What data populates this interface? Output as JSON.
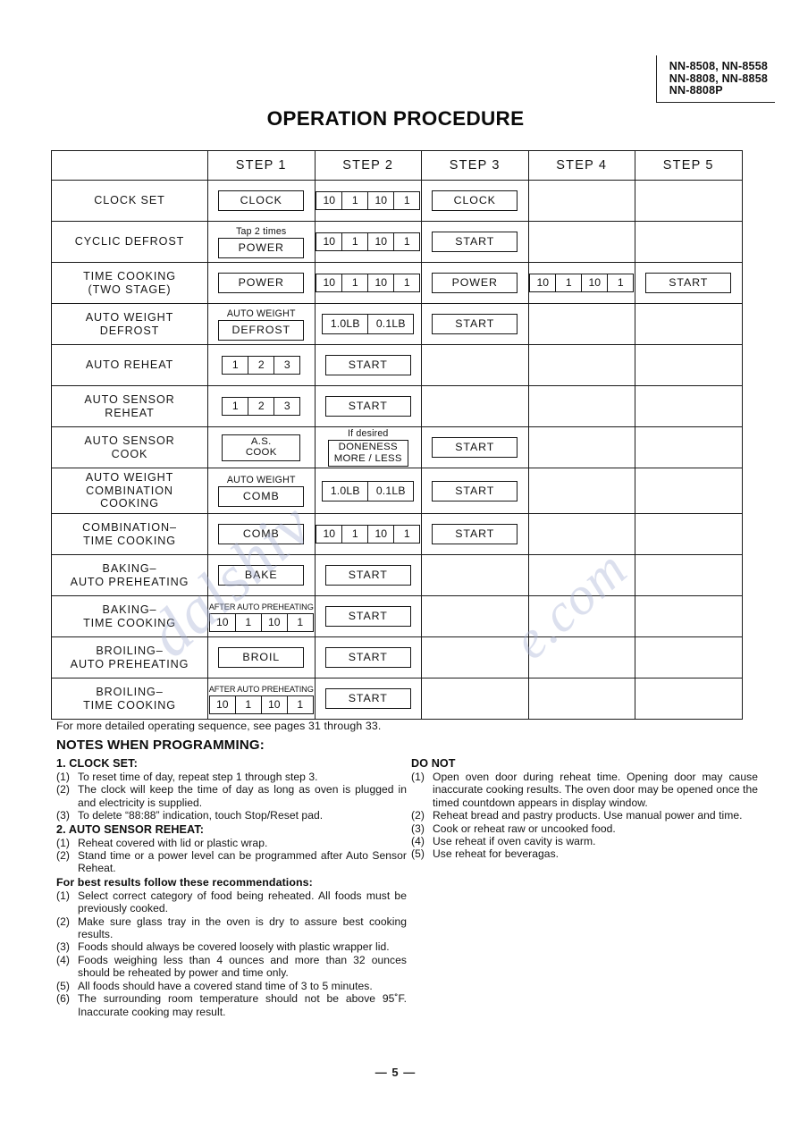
{
  "document": {
    "title": "OPERATION PROCEDURE",
    "page_number": "— 5 —"
  },
  "models": {
    "line1": "NN-8508, NN-8558",
    "line2": "NN-8808, NN-8858",
    "line3": "NN-8808P"
  },
  "watermark": {
    "text_a": "dalshiv",
    "text_b": "e.com"
  },
  "table": {
    "headers": [
      "",
      "STEP 1",
      "STEP 2",
      "STEP 3",
      "STEP 4",
      "STEP 5"
    ],
    "rows": [
      {
        "label_line1": "CLOCK SET",
        "label_line2": "",
        "label_line3": "",
        "step1": {
          "type": "pad",
          "caption": "",
          "text": "CLOCK"
        },
        "step2": {
          "type": "digits",
          "caption": "",
          "segments": [
            "10",
            "1",
            "10",
            "1"
          ]
        },
        "step3": {
          "type": "pad",
          "caption": "",
          "text": "CLOCK"
        },
        "step4": {
          "type": "empty"
        },
        "step5": {
          "type": "empty"
        }
      },
      {
        "label_line1": "CYCLIC DEFROST",
        "label_line2": "",
        "label_line3": "",
        "step1": {
          "type": "pad",
          "caption": "Tap 2 times",
          "text": "POWER"
        },
        "step2": {
          "type": "digits",
          "caption": "",
          "segments": [
            "10",
            "1",
            "10",
            "1"
          ]
        },
        "step3": {
          "type": "pad",
          "caption": "",
          "text": "START"
        },
        "step4": {
          "type": "empty"
        },
        "step5": {
          "type": "empty"
        }
      },
      {
        "label_line1": "TIME COOKING",
        "label_line2": "(TWO STAGE)",
        "label_line3": "",
        "step1": {
          "type": "pad",
          "caption": "",
          "text": "POWER"
        },
        "step2": {
          "type": "digits",
          "caption": "",
          "segments": [
            "10",
            "1",
            "10",
            "1"
          ]
        },
        "step3": {
          "type": "pad",
          "caption": "",
          "text": "POWER"
        },
        "step4": {
          "type": "digits",
          "caption": "",
          "segments": [
            "10",
            "1",
            "10",
            "1"
          ]
        },
        "step5": {
          "type": "pad",
          "caption": "",
          "text": "START"
        }
      },
      {
        "label_line1": "AUTO WEIGHT",
        "label_line2": "DEFROST",
        "label_line3": "",
        "step1": {
          "type": "pad",
          "caption": "AUTO WEIGHT",
          "text": "DEFROST"
        },
        "step2": {
          "type": "lb",
          "caption": "",
          "segments": [
            "1.0LB",
            "0.1LB"
          ]
        },
        "step3": {
          "type": "pad",
          "caption": "",
          "text": "START"
        },
        "step4": {
          "type": "empty"
        },
        "step5": {
          "type": "empty"
        }
      },
      {
        "label_line1": "AUTO REHEAT",
        "label_line2": "",
        "label_line3": "",
        "step1": {
          "type": "digits",
          "caption": "",
          "segments": [
            "1",
            "2",
            "3"
          ]
        },
        "step2": {
          "type": "pad",
          "caption": "",
          "text": "START"
        },
        "step3": {
          "type": "empty"
        },
        "step4": {
          "type": "empty"
        },
        "step5": {
          "type": "empty"
        }
      },
      {
        "label_line1": "AUTO SENSOR",
        "label_line2": "REHEAT",
        "label_line3": "",
        "step1": {
          "type": "digits",
          "caption": "",
          "segments": [
            "1",
            "2",
            "3"
          ]
        },
        "step2": {
          "type": "pad",
          "caption": "",
          "text": "START"
        },
        "step3": {
          "type": "empty"
        },
        "step4": {
          "type": "empty"
        },
        "step5": {
          "type": "empty"
        }
      },
      {
        "label_line1": "AUTO SENSOR",
        "label_line2": "COOK",
        "label_line3": "",
        "step1": {
          "type": "pad2",
          "caption": "",
          "text_line1": "A.S.",
          "text_line2": "COOK"
        },
        "step2": {
          "type": "pad2",
          "caption": "If desired",
          "text_line1": "DONENESS",
          "text_line2": "MORE / LESS"
        },
        "step3": {
          "type": "pad",
          "caption": "",
          "text": "START"
        },
        "step4": {
          "type": "empty"
        },
        "step5": {
          "type": "empty"
        }
      },
      {
        "label_line1": "AUTO WEIGHT",
        "label_line2": "COMBINATION",
        "label_line3": "COOKING",
        "step1": {
          "type": "pad",
          "caption": "AUTO WEIGHT",
          "text": "COMB"
        },
        "step2": {
          "type": "lb",
          "caption": "",
          "segments": [
            "1.0LB",
            "0.1LB"
          ]
        },
        "step3": {
          "type": "pad",
          "caption": "",
          "text": "START"
        },
        "step4": {
          "type": "empty"
        },
        "step5": {
          "type": "empty"
        }
      },
      {
        "label_line1": "COMBINATION–",
        "label_line2": "TIME COOKING",
        "label_line3": "",
        "step1": {
          "type": "pad",
          "caption": "",
          "text": "COMB"
        },
        "step2": {
          "type": "digits",
          "caption": "",
          "segments": [
            "10",
            "1",
            "10",
            "1"
          ]
        },
        "step3": {
          "type": "pad",
          "caption": "",
          "text": "START"
        },
        "step4": {
          "type": "empty"
        },
        "step5": {
          "type": "empty"
        }
      },
      {
        "label_line1": "BAKING–",
        "label_line2": "AUTO PREHEATING",
        "label_line3": "",
        "step1": {
          "type": "pad",
          "caption": "",
          "text": "BAKE"
        },
        "step2": {
          "type": "pad",
          "caption": "",
          "text": "START"
        },
        "step3": {
          "type": "empty"
        },
        "step4": {
          "type": "empty"
        },
        "step5": {
          "type": "empty"
        }
      },
      {
        "label_line1": "BAKING–",
        "label_line2": "TIME COOKING",
        "label_line3": "",
        "step1": {
          "type": "digits",
          "caption": "AFTER AUTO PREHEATING",
          "segments": [
            "10",
            "1",
            "10",
            "1"
          ]
        },
        "step2": {
          "type": "pad",
          "caption": "",
          "text": "START"
        },
        "step3": {
          "type": "empty"
        },
        "step4": {
          "type": "empty"
        },
        "step5": {
          "type": "empty"
        }
      },
      {
        "label_line1": "BROILING–",
        "label_line2": "AUTO PREHEATING",
        "label_line3": "",
        "step1": {
          "type": "pad",
          "caption": "",
          "text": "BROIL"
        },
        "step2": {
          "type": "pad",
          "caption": "",
          "text": "START"
        },
        "step3": {
          "type": "empty"
        },
        "step4": {
          "type": "empty"
        },
        "step5": {
          "type": "empty"
        }
      },
      {
        "label_line1": "BROILING–",
        "label_line2": "TIME COOKING",
        "label_line3": "",
        "step1": {
          "type": "digits",
          "caption": "AFTER AUTO PREHEATING",
          "segments": [
            "10",
            "1",
            "10",
            "1"
          ]
        },
        "step2": {
          "type": "pad",
          "caption": "",
          "text": "START"
        },
        "step3": {
          "type": "empty"
        },
        "step4": {
          "type": "empty"
        },
        "step5": {
          "type": "empty"
        }
      }
    ],
    "footnote": "For more detailed operating sequence, see pages 31 through 33."
  },
  "notes": {
    "heading": "NOTES WHEN PROGRAMMING:",
    "section1_title": "1. CLOCK SET:",
    "section1_items": [
      {
        "mark": "(1)",
        "text": "To reset time of day, repeat step 1 through step 3."
      },
      {
        "mark": "(2)",
        "text": "The clock will keep the time of day as long as oven is plugged in and electricity is supplied."
      },
      {
        "mark": "(3)",
        "text": "To delete “88:88” indication, touch Stop/Reset pad."
      }
    ],
    "section2_title": "2. AUTO SENSOR REHEAT:",
    "section2_items": [
      {
        "mark": "(1)",
        "text": "Reheat covered with lid or plastic wrap."
      },
      {
        "mark": "(2)",
        "text": "Stand time or a power level can be programmed after Auto Sensor Reheat."
      }
    ],
    "recommend_title": "For best results follow these recommendations:",
    "recommend_items": [
      {
        "mark": "(1)",
        "text": "Select correct category of food being reheated. All foods must be previously cooked."
      },
      {
        "mark": "(2)",
        "text": "Make sure glass tray in the oven is dry to assure best cooking results."
      },
      {
        "mark": "(3)",
        "text": "Foods should always be covered loosely with plastic wrapper lid."
      },
      {
        "mark": "(4)",
        "text": "Foods weighing less than 4 ounces and more than 32 ounces should be reheated by power and time only."
      },
      {
        "mark": "(5)",
        "text": "All foods should have a covered stand time of 3 to 5 minutes."
      },
      {
        "mark": "(6)",
        "text": "The surrounding room temperature should not be above 95˚F. Inaccurate cooking may result."
      }
    ],
    "donot_title": "DO NOT",
    "donot_items": [
      {
        "mark": "(1)",
        "text": "Open oven door during reheat time. Opening door may cause inaccurate cooking results. The oven door may be opened once the timed countdown appears in display window."
      },
      {
        "mark": "(2)",
        "text": "Reheat bread and pastry products. Use manual power and time."
      },
      {
        "mark": "(3)",
        "text": "Cook or reheat raw or uncooked food."
      },
      {
        "mark": "(4)",
        "text": "Use reheat if oven cavity is warm."
      },
      {
        "mark": "(5)",
        "text": "Use reheat for beveragas."
      }
    ]
  }
}
